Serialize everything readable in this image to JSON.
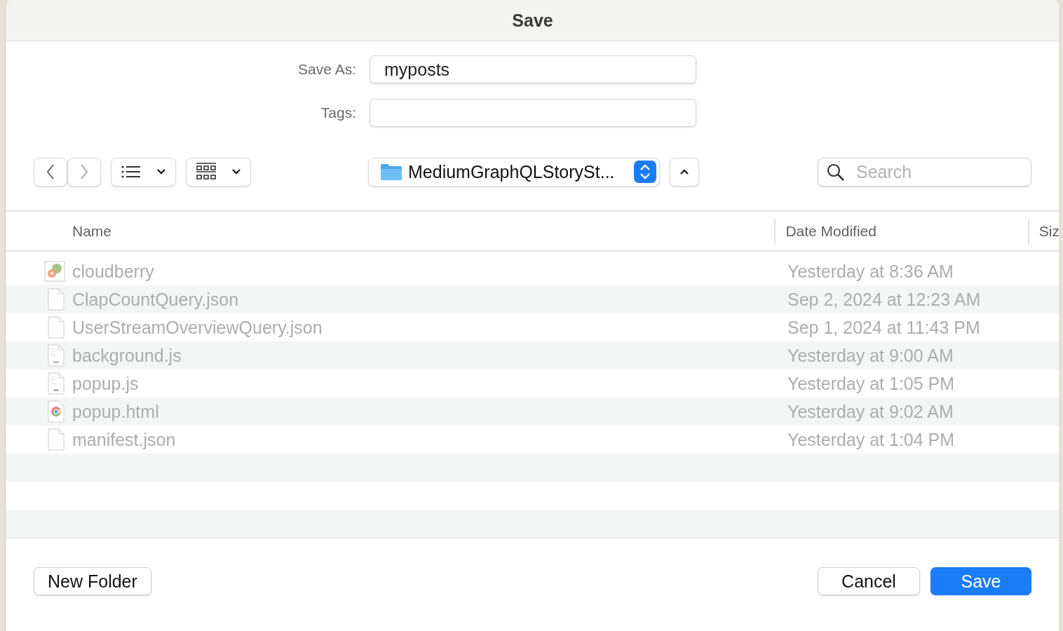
{
  "window": {
    "title": "Save"
  },
  "save_as": {
    "label": "Save As:",
    "value": "myposts"
  },
  "tags": {
    "label": "Tags:"
  },
  "location": {
    "label": "MediumGraphQLStorySt..."
  },
  "search": {
    "placeholder": "Search"
  },
  "table": {
    "columns": [
      {
        "label": "Name"
      },
      {
        "label": "Date Modified"
      },
      {
        "label": "Siz"
      }
    ],
    "rows": [
      {
        "name": "cloudberry",
        "date": "Yesterday at 8:36 AM",
        "kind": "image",
        "disabled": true
      },
      {
        "name": "ClapCountQuery.json",
        "date": "Sep 2, 2024 at 12:23 AM",
        "kind": "document",
        "disabled": true
      },
      {
        "name": "UserStreamOverviewQuery.json",
        "date": "Sep 1, 2024 at 11:43 PM",
        "kind": "document",
        "disabled": true
      },
      {
        "name": "background.js",
        "date": "Yesterday at 9:00 AM",
        "kind": "script",
        "disabled": true
      },
      {
        "name": "popup.js",
        "date": "Yesterday at 1:05 PM",
        "kind": "script",
        "disabled": true
      },
      {
        "name": "popup.html",
        "date": "Yesterday at 9:02 AM",
        "kind": "browser",
        "disabled": true
      },
      {
        "name": "manifest.json",
        "date": "Yesterday at 1:04 PM",
        "kind": "document",
        "disabled": true
      }
    ]
  },
  "buttons": {
    "new_folder": "New Folder",
    "cancel": "Cancel",
    "save": "Save"
  }
}
